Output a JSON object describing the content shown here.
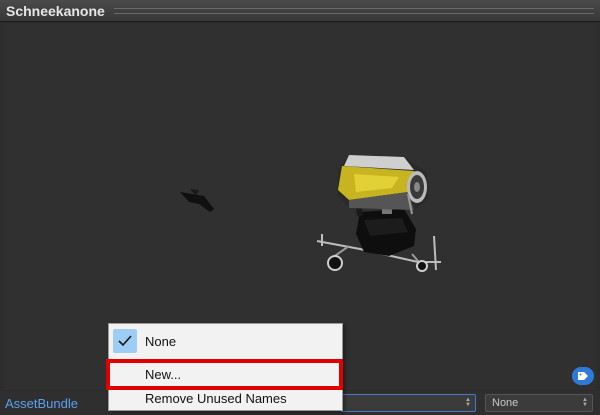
{
  "window": {
    "title": "Schneekanone"
  },
  "preview": {
    "background": "#303030",
    "model": "snow-cannon"
  },
  "asset_bar": {
    "label": "AssetBundle",
    "name_select": {
      "value": ""
    },
    "variant_select": {
      "value": "None"
    }
  },
  "dropdown": {
    "items": [
      {
        "label": "None",
        "checked": true
      },
      {
        "label": "New..."
      },
      {
        "label": "Remove Unused Names"
      }
    ],
    "highlighted_index": 1
  },
  "colors": {
    "highlight": "#e00000",
    "accent": "#5aa0f0",
    "check_bg": "#9dcdf5"
  }
}
